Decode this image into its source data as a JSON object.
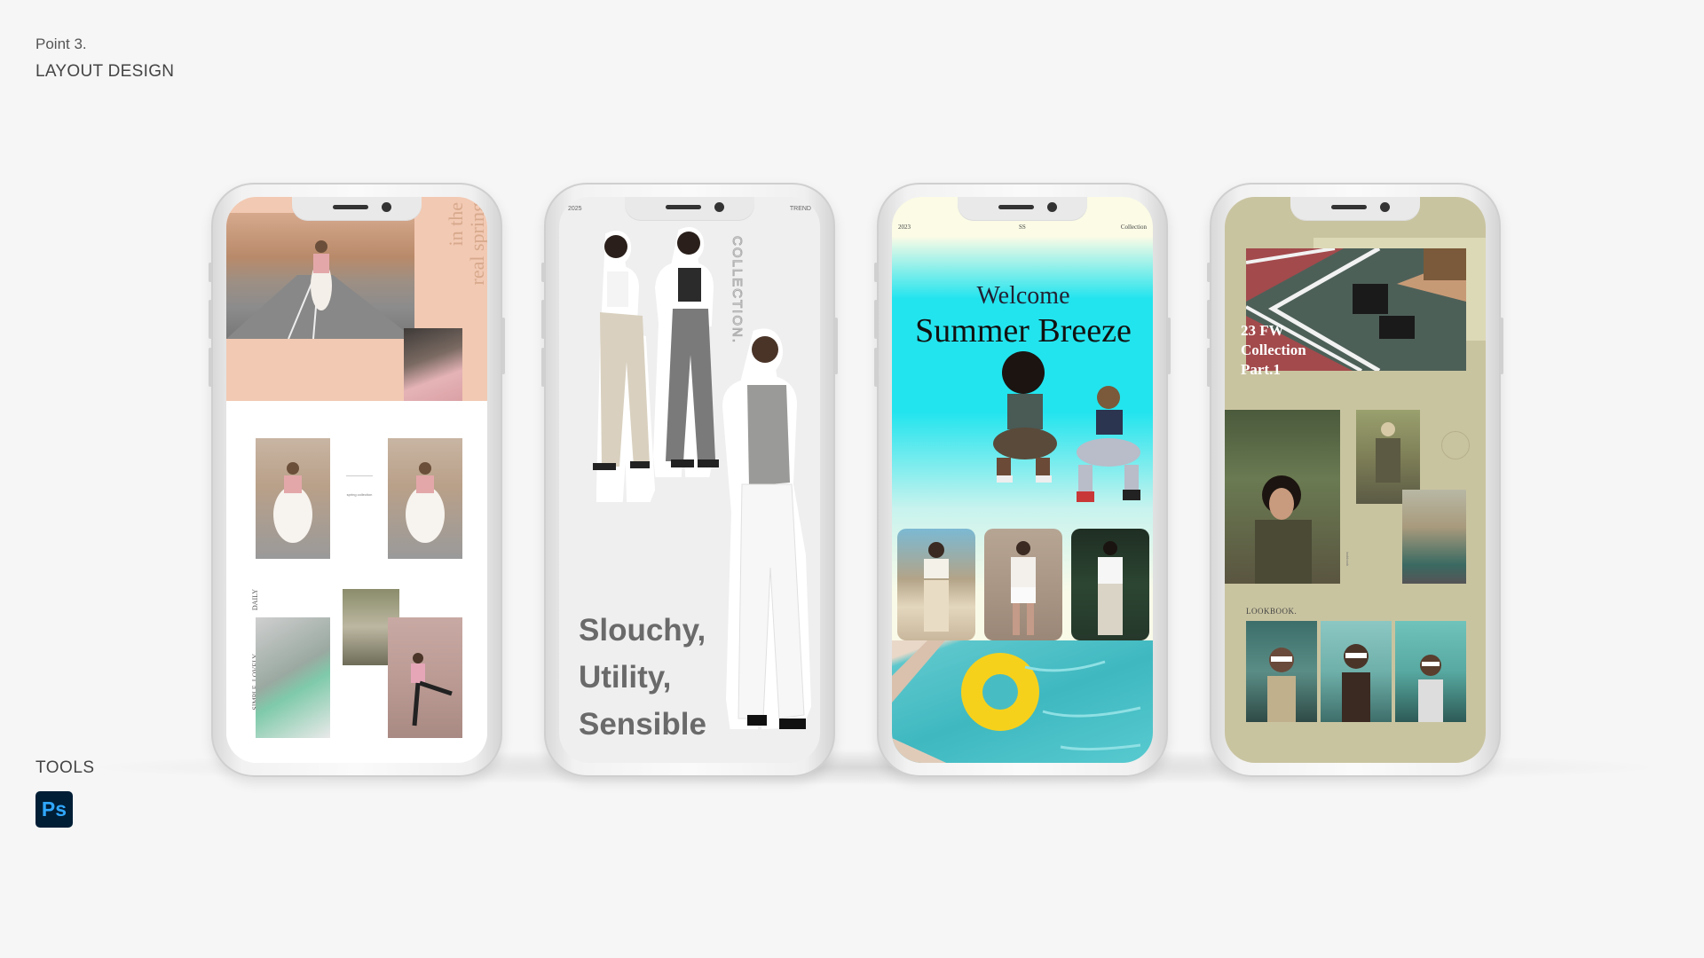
{
  "header": {
    "point": "Point 3.",
    "title": "LAYOUT DESIGN"
  },
  "tools": {
    "label": "TOOLS",
    "icon_text": "Ps",
    "icon_name": "photoshop-icon"
  },
  "phone1": {
    "vertical_text_1": "in the",
    "vertical_text_2": "real spring",
    "mid_caption": "spring collection",
    "side_label_1": "DAILY",
    "side_label_2": "SIMPLE, LOVELY",
    "bg_color": "#f2c9b3"
  },
  "phone2": {
    "corner_left": "2025",
    "corner_right": "TREND",
    "vertical_text": "COLLECTION.",
    "headline": [
      "Slouchy,",
      "Utility,",
      "Sensible"
    ]
  },
  "phone3": {
    "corner_left": "2023",
    "corner_center": "SS",
    "corner_right": "Collection",
    "welcome": "Welcome",
    "title": "Summer Breeze",
    "accent_color": "#20e6ee"
  },
  "phone4": {
    "title_lines": [
      "23 FW",
      "Collection",
      "Part.1"
    ],
    "lookbook_label": "LOOKBOOK.",
    "bg_color": "#c9c4a0"
  }
}
